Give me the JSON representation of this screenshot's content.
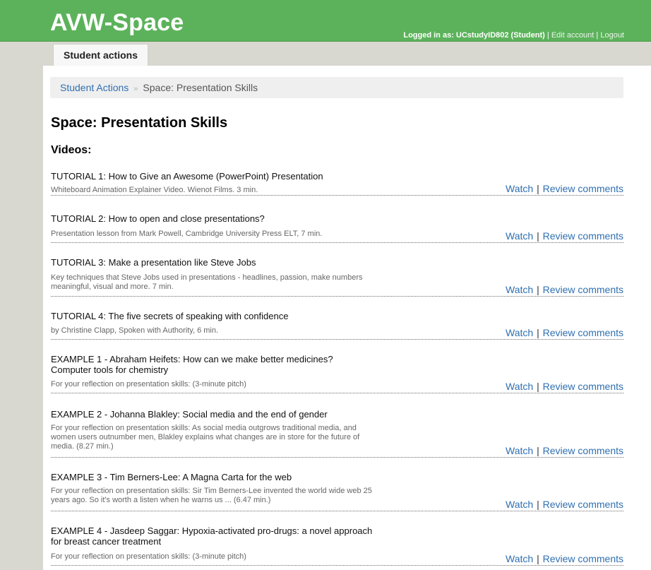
{
  "app": {
    "logo": "AVW-Space",
    "logged_in_label": "Logged in as: UCstudyID802 (Student)",
    "separator": "|",
    "edit_account": "Edit account",
    "logout": "Logout"
  },
  "tabs": [
    {
      "label": "Student actions",
      "active": true
    }
  ],
  "breadcrumb": {
    "root": "Student Actions",
    "divider": "»",
    "current": "Space: Presentation Skills"
  },
  "page": {
    "title": "Space: Presentation Skills",
    "videos_heading": "Videos:"
  },
  "actions": {
    "watch": "Watch",
    "separator": "|",
    "review": "Review comments"
  },
  "videos": [
    {
      "title": "TUTORIAL 1: How to Give an Awesome (PowerPoint) Presentation",
      "description": "Whiteboard Animation Explainer Video. Wienot Films. 3 min."
    },
    {
      "title": "TUTORIAL 2: How to open and close presentations?",
      "description": "Presentation lesson from Mark Powell, Cambridge University Press ELT, 7 min."
    },
    {
      "title": "TUTORIAL 3: Make a presentation like Steve Jobs",
      "description": "Key techniques that Steve Jobs used in presentations - headlines, passion, make numbers meaningful, visual and more. 7 min."
    },
    {
      "title": "TUTORIAL 4: The five secrets of speaking with confidence",
      "description": "by Christine Clapp, Spoken with Authority, 6 min."
    },
    {
      "title": "EXAMPLE 1 - Abraham Heifets: How can we make better medicines? Computer tools for chemistry",
      "description": "For your reflection on presentation skills: (3-minute pitch)"
    },
    {
      "title": "EXAMPLE 2 - Johanna Blakley: Social media and the end of gender",
      "description": "For your reflection on presentation skills: As social media outgrows traditional media, and women users outnumber men, Blakley explains what changes are in store for the future of media. (8.27 min.)"
    },
    {
      "title": "EXAMPLE 3 - Tim Berners-Lee: A Magna Carta for the web",
      "description": "For your reflection on presentation skills: Sir Tim Berners-Lee invented the world wide web 25 years ago. So it's worth a listen when he warns us ... (6.47 min.)"
    },
    {
      "title": "EXAMPLE 4 - Jasdeep Saggar: Hypoxia-activated pro-drugs: a novel approach for breast cancer treatment",
      "description": "For your reflection on presentation skills: (3-minute pitch)"
    }
  ],
  "colors": {
    "header_green": "#5cb25b",
    "link_blue": "#2f6fb0",
    "page_background": "#d9d8d0"
  }
}
